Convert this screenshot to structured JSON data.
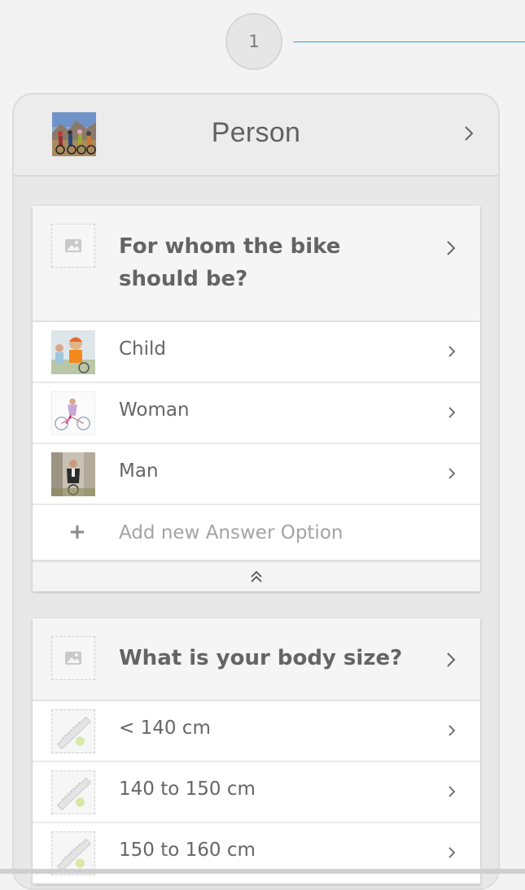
{
  "step": {
    "number": "1"
  },
  "category": {
    "title": "Person"
  },
  "questions": [
    {
      "title": "For whom the bike should be?",
      "options": [
        {
          "label": "Child",
          "image": "child-photo"
        },
        {
          "label": "Woman",
          "image": "woman-photo"
        },
        {
          "label": "Man",
          "image": "man-photo"
        }
      ],
      "add_option_label": "Add new Answer Option",
      "add_icon": "+"
    },
    {
      "title": "What is your body size?",
      "options": [
        {
          "label": "< 140 cm",
          "image": "measuring-tape-photo"
        },
        {
          "label": "140 to 150 cm",
          "image": "measuring-tape-photo"
        },
        {
          "label": "150 to 160 cm",
          "image": "measuring-tape-photo"
        }
      ]
    }
  ],
  "colors": {
    "accent_line": "#3a9bd5",
    "panel_bg": "#e8e8e8",
    "page_bg": "#f3f3f3"
  },
  "icons": {
    "chevron": "chevron-right-icon",
    "collapse": "double-chevron-up-icon",
    "placeholder": "image-placeholder-icon"
  }
}
